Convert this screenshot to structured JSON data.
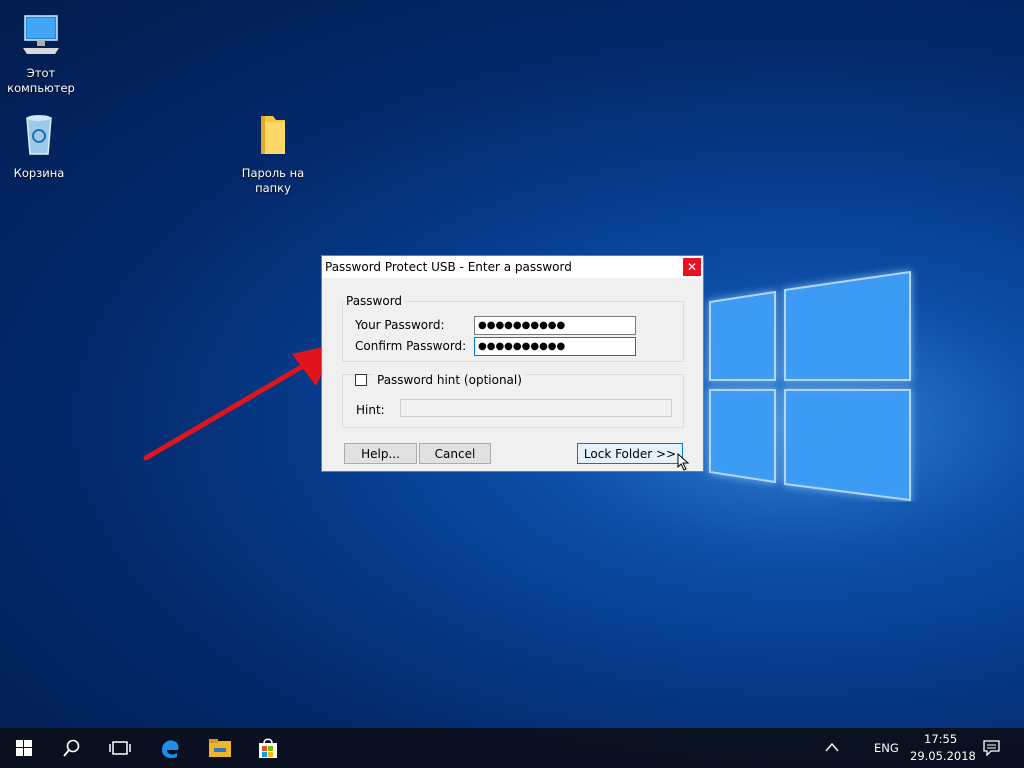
{
  "desktop": {
    "icons": [
      {
        "label": "Этот компьютер",
        "icon": "computer-icon"
      },
      {
        "label": "Корзина",
        "icon": "recycle-bin-icon"
      },
      {
        "label": "Пароль на папку",
        "icon": "folder-icon"
      }
    ]
  },
  "dialog": {
    "title": "Password Protect USB - Enter a password",
    "close_glyph": "✕",
    "password_group_label": "Password",
    "your_password_label": "Your Password:",
    "your_password_value": "●●●●●●●●●●",
    "confirm_password_label": "Confirm Password:",
    "confirm_password_value": "●●●●●●●●●●",
    "hint_checkbox_label": "Password hint (optional)",
    "hint_label": "Hint:",
    "hint_value": "",
    "help_button": "Help...",
    "cancel_button": "Cancel",
    "lock_button": "Lock Folder >>"
  },
  "taskbar": {
    "apps": [
      "start-icon",
      "search-icon",
      "task-view-icon",
      "edge-icon",
      "file-explorer-icon",
      "store-icon"
    ],
    "language": "ENG",
    "time": "17:55",
    "date": "29.05.2018"
  },
  "colors": {
    "accent": "#0078d7",
    "close": "#e81123",
    "annotation_arrow": "#e0141c"
  }
}
